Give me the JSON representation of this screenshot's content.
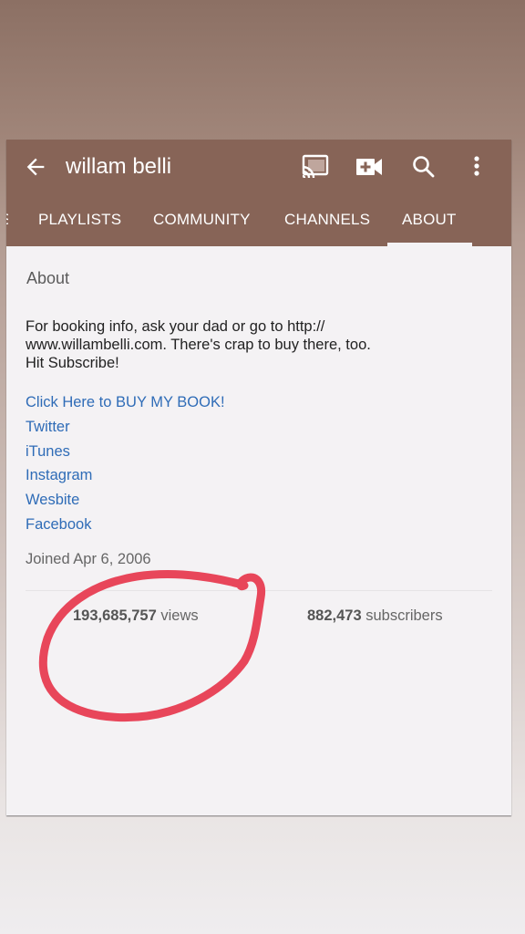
{
  "app_bar": {
    "title": "willam belli",
    "icons": {
      "back": "arrow-left-icon",
      "cast": "cast-icon",
      "upload": "video-add-icon",
      "search": "search-icon",
      "more": "more-vertical-icon"
    }
  },
  "tabs": [
    {
      "label": "S",
      "active": false
    },
    {
      "label": "PLAYLISTS",
      "active": false
    },
    {
      "label": "COMMUNITY",
      "active": false
    },
    {
      "label": "CHANNELS",
      "active": false
    },
    {
      "label": "ABOUT",
      "active": true
    }
  ],
  "about": {
    "section_title": "About",
    "description_lines": [
      "For booking info, ask your dad or go to  http://",
      "www.willambelli.com. There's crap to buy there, too.",
      "Hit Subscribe!"
    ],
    "links": [
      "Click Here to BUY MY BOOK!",
      "Twitter",
      "iTunes",
      "Instagram",
      "Wesbite",
      "Facebook"
    ],
    "joined": "Joined Apr 6, 2006",
    "stats": {
      "views_value": "193,685,757",
      "views_label": " views",
      "subscribers_value": "882,473",
      "subscribers_label": " subscribers"
    }
  },
  "colors": {
    "app_bar": "#876457",
    "link": "#2f6cb7",
    "annotation": "#e8465a",
    "card_bg": "#f4f2f4"
  },
  "annotation": {
    "type": "hand-drawn circle",
    "target": "views count"
  }
}
